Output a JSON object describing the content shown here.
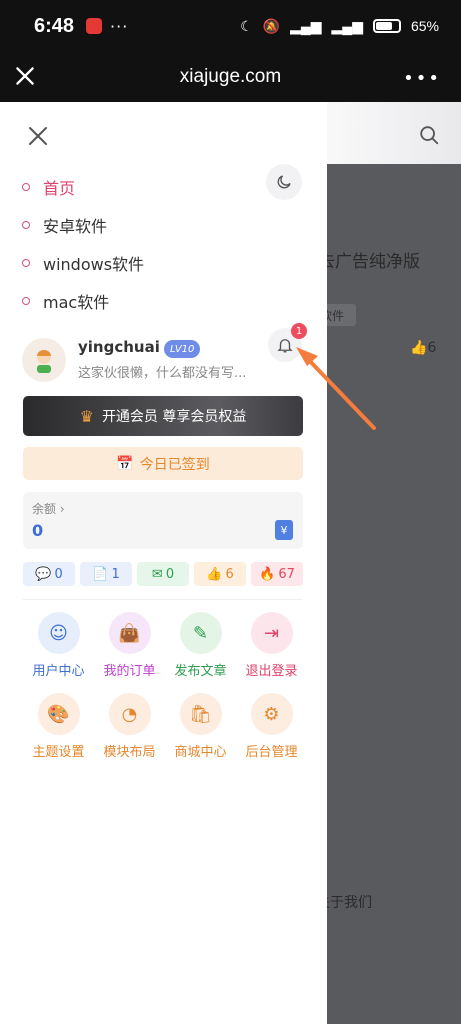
{
  "status_bar": {
    "time": "6:48",
    "battery": "65%"
  },
  "browser": {
    "url": "xiajuge.com"
  },
  "background_page": {
    "headline": "去广告纯净版",
    "tag": "软件",
    "likes": "6",
    "footer_text": "关于我们"
  },
  "drawer": {
    "menu": [
      {
        "label": "首页",
        "active": true
      },
      {
        "label": "安卓软件",
        "active": false
      },
      {
        "label": "windows软件",
        "active": false
      },
      {
        "label": "mac软件",
        "active": false
      }
    ],
    "user": {
      "name": "yingchuai",
      "level": "LV10",
      "bio": "这家伙很懒，什么都没有写...",
      "notification_count": "1"
    },
    "vip_button": "开通会员 尊享会员权益",
    "signed_button": "今日已签到",
    "balance": {
      "label": "余额",
      "value": "0"
    },
    "stats": [
      {
        "icon": "comment-icon",
        "value": "0",
        "color": "#3c6ed6",
        "bg": "#e9f0fc"
      },
      {
        "icon": "document-icon",
        "value": "1",
        "color": "#3c6ed6",
        "bg": "#e9f0fc"
      },
      {
        "icon": "message-icon",
        "value": "0",
        "color": "#2e9d4f",
        "bg": "#e6f6ea"
      },
      {
        "icon": "thumbs-up-icon",
        "value": "6",
        "color": "#e5872d",
        "bg": "#fdeedd"
      },
      {
        "icon": "fire-icon",
        "value": "67",
        "color": "#e8435c",
        "bg": "#fde7ea"
      }
    ],
    "actions": [
      {
        "label": "用户中心",
        "icon": "user-badge-icon",
        "color": "#3c6ed6",
        "bg": "#e6eefc"
      },
      {
        "label": "我的订单",
        "icon": "bag-icon",
        "color": "#c13fd0",
        "bg": "#f6e6f9"
      },
      {
        "label": "发布文章",
        "icon": "edit-icon",
        "color": "#2e9d4f",
        "bg": "#e4f5e8"
      },
      {
        "label": "退出登录",
        "icon": "logout-icon",
        "color": "#e0436e",
        "bg": "#fce6ec"
      },
      {
        "label": "主题设置",
        "icon": "palette-icon",
        "color": "#e5872d",
        "bg": "#fdece0"
      },
      {
        "label": "模块布局",
        "icon": "pie-chart-icon",
        "color": "#e5872d",
        "bg": "#fdece0"
      },
      {
        "label": "商城中心",
        "icon": "shopping-bag-icon",
        "color": "#e5872d",
        "bg": "#fdece0"
      },
      {
        "label": "后台管理",
        "icon": "gear-icon",
        "color": "#e5872d",
        "bg": "#fdece0"
      }
    ]
  }
}
